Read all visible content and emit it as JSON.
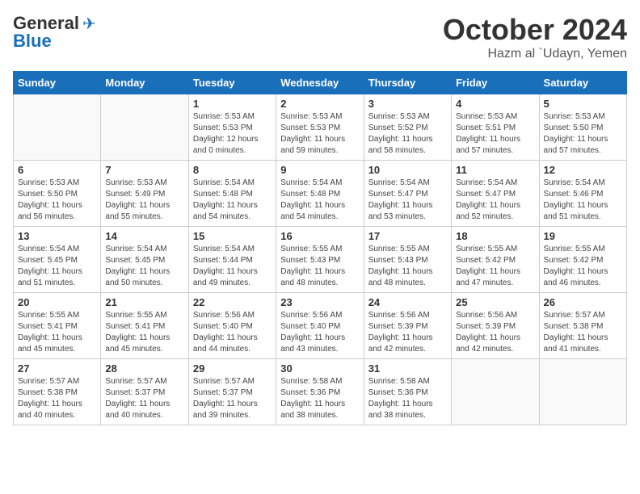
{
  "header": {
    "logo_general": "General",
    "logo_blue": "Blue",
    "month": "October 2024",
    "location": "Hazm al `Udayn, Yemen"
  },
  "weekdays": [
    "Sunday",
    "Monday",
    "Tuesday",
    "Wednesday",
    "Thursday",
    "Friday",
    "Saturday"
  ],
  "weeks": [
    [
      {
        "day": "",
        "info": ""
      },
      {
        "day": "",
        "info": ""
      },
      {
        "day": "1",
        "info": "Sunrise: 5:53 AM\nSunset: 5:53 PM\nDaylight: 12 hours\nand 0 minutes."
      },
      {
        "day": "2",
        "info": "Sunrise: 5:53 AM\nSunset: 5:53 PM\nDaylight: 11 hours\nand 59 minutes."
      },
      {
        "day": "3",
        "info": "Sunrise: 5:53 AM\nSunset: 5:52 PM\nDaylight: 11 hours\nand 58 minutes."
      },
      {
        "day": "4",
        "info": "Sunrise: 5:53 AM\nSunset: 5:51 PM\nDaylight: 11 hours\nand 57 minutes."
      },
      {
        "day": "5",
        "info": "Sunrise: 5:53 AM\nSunset: 5:50 PM\nDaylight: 11 hours\nand 57 minutes."
      }
    ],
    [
      {
        "day": "6",
        "info": "Sunrise: 5:53 AM\nSunset: 5:50 PM\nDaylight: 11 hours\nand 56 minutes."
      },
      {
        "day": "7",
        "info": "Sunrise: 5:53 AM\nSunset: 5:49 PM\nDaylight: 11 hours\nand 55 minutes."
      },
      {
        "day": "8",
        "info": "Sunrise: 5:54 AM\nSunset: 5:48 PM\nDaylight: 11 hours\nand 54 minutes."
      },
      {
        "day": "9",
        "info": "Sunrise: 5:54 AM\nSunset: 5:48 PM\nDaylight: 11 hours\nand 54 minutes."
      },
      {
        "day": "10",
        "info": "Sunrise: 5:54 AM\nSunset: 5:47 PM\nDaylight: 11 hours\nand 53 minutes."
      },
      {
        "day": "11",
        "info": "Sunrise: 5:54 AM\nSunset: 5:47 PM\nDaylight: 11 hours\nand 52 minutes."
      },
      {
        "day": "12",
        "info": "Sunrise: 5:54 AM\nSunset: 5:46 PM\nDaylight: 11 hours\nand 51 minutes."
      }
    ],
    [
      {
        "day": "13",
        "info": "Sunrise: 5:54 AM\nSunset: 5:45 PM\nDaylight: 11 hours\nand 51 minutes."
      },
      {
        "day": "14",
        "info": "Sunrise: 5:54 AM\nSunset: 5:45 PM\nDaylight: 11 hours\nand 50 minutes."
      },
      {
        "day": "15",
        "info": "Sunrise: 5:54 AM\nSunset: 5:44 PM\nDaylight: 11 hours\nand 49 minutes."
      },
      {
        "day": "16",
        "info": "Sunrise: 5:55 AM\nSunset: 5:43 PM\nDaylight: 11 hours\nand 48 minutes."
      },
      {
        "day": "17",
        "info": "Sunrise: 5:55 AM\nSunset: 5:43 PM\nDaylight: 11 hours\nand 48 minutes."
      },
      {
        "day": "18",
        "info": "Sunrise: 5:55 AM\nSunset: 5:42 PM\nDaylight: 11 hours\nand 47 minutes."
      },
      {
        "day": "19",
        "info": "Sunrise: 5:55 AM\nSunset: 5:42 PM\nDaylight: 11 hours\nand 46 minutes."
      }
    ],
    [
      {
        "day": "20",
        "info": "Sunrise: 5:55 AM\nSunset: 5:41 PM\nDaylight: 11 hours\nand 45 minutes."
      },
      {
        "day": "21",
        "info": "Sunrise: 5:55 AM\nSunset: 5:41 PM\nDaylight: 11 hours\nand 45 minutes."
      },
      {
        "day": "22",
        "info": "Sunrise: 5:56 AM\nSunset: 5:40 PM\nDaylight: 11 hours\nand 44 minutes."
      },
      {
        "day": "23",
        "info": "Sunrise: 5:56 AM\nSunset: 5:40 PM\nDaylight: 11 hours\nand 43 minutes."
      },
      {
        "day": "24",
        "info": "Sunrise: 5:56 AM\nSunset: 5:39 PM\nDaylight: 11 hours\nand 42 minutes."
      },
      {
        "day": "25",
        "info": "Sunrise: 5:56 AM\nSunset: 5:39 PM\nDaylight: 11 hours\nand 42 minutes."
      },
      {
        "day": "26",
        "info": "Sunrise: 5:57 AM\nSunset: 5:38 PM\nDaylight: 11 hours\nand 41 minutes."
      }
    ],
    [
      {
        "day": "27",
        "info": "Sunrise: 5:57 AM\nSunset: 5:38 PM\nDaylight: 11 hours\nand 40 minutes."
      },
      {
        "day": "28",
        "info": "Sunrise: 5:57 AM\nSunset: 5:37 PM\nDaylight: 11 hours\nand 40 minutes."
      },
      {
        "day": "29",
        "info": "Sunrise: 5:57 AM\nSunset: 5:37 PM\nDaylight: 11 hours\nand 39 minutes."
      },
      {
        "day": "30",
        "info": "Sunrise: 5:58 AM\nSunset: 5:36 PM\nDaylight: 11 hours\nand 38 minutes."
      },
      {
        "day": "31",
        "info": "Sunrise: 5:58 AM\nSunset: 5:36 PM\nDaylight: 11 hours\nand 38 minutes."
      },
      {
        "day": "",
        "info": ""
      },
      {
        "day": "",
        "info": ""
      }
    ]
  ]
}
